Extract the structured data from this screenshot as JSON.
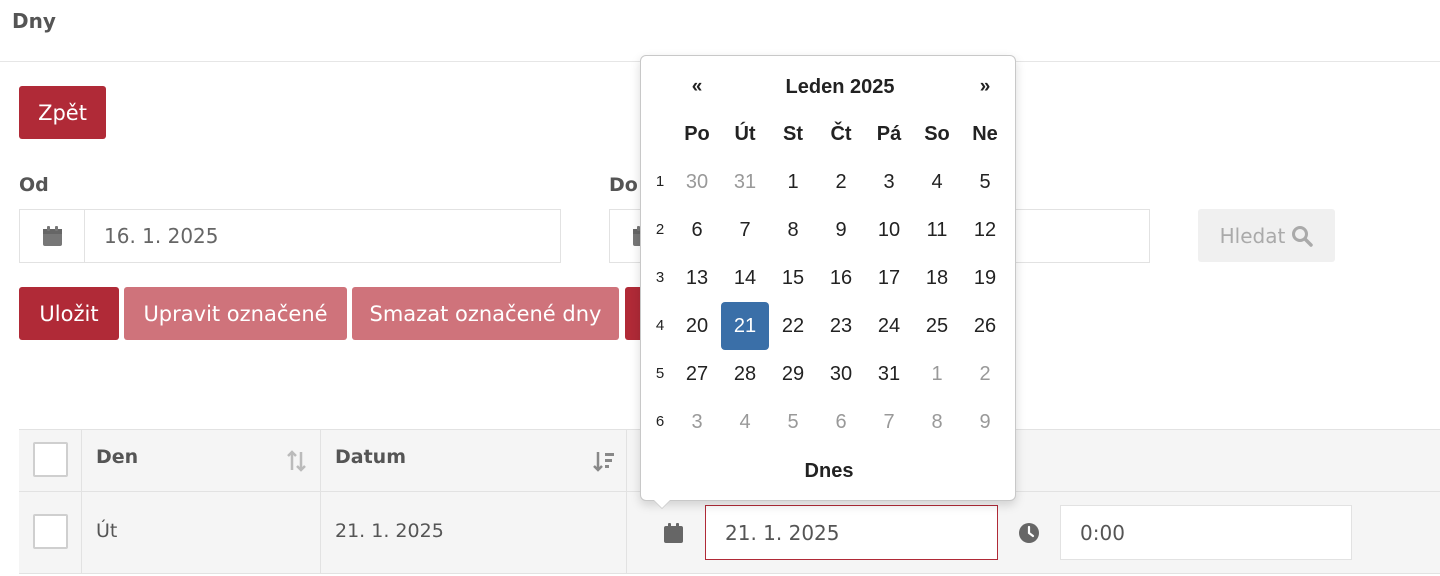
{
  "header": {
    "title": "Dny"
  },
  "buttons": {
    "back": "Zpět",
    "save": "Uložit",
    "edit_selected": "Upravit označené",
    "delete_selected": "Smazat označené dny",
    "search": "Hledat"
  },
  "filter": {
    "from_label": "Od",
    "from_value": "16. 1. 2025",
    "to_label": "Do",
    "to_value": ""
  },
  "table": {
    "columns": [
      "Den",
      "Datum"
    ],
    "rows": [
      {
        "day": "Út",
        "date": "21. 1. 2025",
        "edit_date": "21. 1. 2025",
        "edit_time": "0:00"
      }
    ]
  },
  "datepicker": {
    "prev": "«",
    "next": "»",
    "title": "Leden 2025",
    "weekdays": [
      "Po",
      "Út",
      "St",
      "Čt",
      "Pá",
      "So",
      "Ne"
    ],
    "weeks": [
      {
        "num": "1",
        "days": [
          "30",
          "31",
          "1",
          "2",
          "3",
          "4",
          "5"
        ]
      },
      {
        "num": "2",
        "days": [
          "6",
          "7",
          "8",
          "9",
          "10",
          "11",
          "12"
        ]
      },
      {
        "num": "3",
        "days": [
          "13",
          "14",
          "15",
          "16",
          "17",
          "18",
          "19"
        ]
      },
      {
        "num": "4",
        "days": [
          "20",
          "21",
          "22",
          "23",
          "24",
          "25",
          "26"
        ]
      },
      {
        "num": "5",
        "days": [
          "27",
          "28",
          "29",
          "30",
          "31",
          "1",
          "2"
        ]
      },
      {
        "num": "6",
        "days": [
          "3",
          "4",
          "5",
          "6",
          "7",
          "8",
          "9"
        ]
      }
    ],
    "selected": "21",
    "today_label": "Dnes"
  },
  "colors": {
    "primary": "#b02a37",
    "primary_light": "#cf737b",
    "selected_day": "#3a6fa8"
  }
}
